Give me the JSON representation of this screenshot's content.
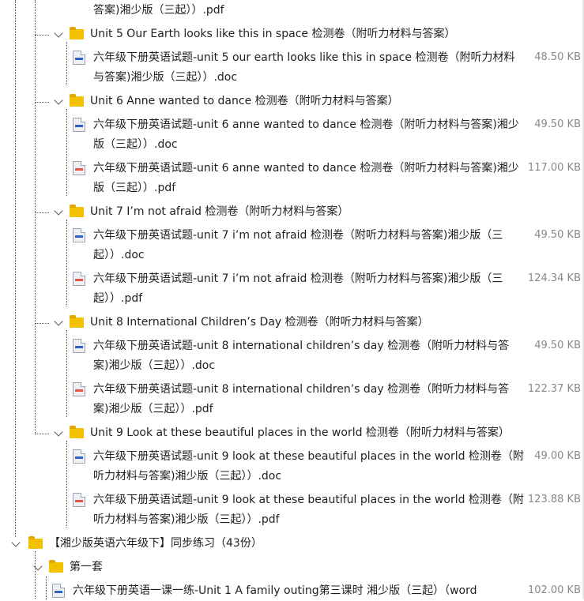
{
  "top_fragment": {
    "text": "答案)湘少版（三起））.pdf"
  },
  "folders": [
    {
      "label": "Unit 5 Our Earth looks like this in space 检测卷（附听力材料与答案）",
      "files": [
        {
          "type": "doc",
          "name": "六年级下册英语试题-unit 5 our earth looks like this in space 检测卷（附听力材料与答案)湘少版（三起））.doc",
          "size": "48.50 KB"
        }
      ]
    },
    {
      "label": "Unit 6 Anne wanted to dance 检测卷（附听力材料与答案）",
      "files": [
        {
          "type": "doc",
          "name": "六年级下册英语试题-unit 6 anne wanted to dance 检测卷（附听力材料与答案)湘少版（三起））.doc",
          "size": "49.50 KB"
        },
        {
          "type": "pdf",
          "name": "六年级下册英语试题-unit 6 anne wanted to dance 检测卷（附听力材料与答案)湘少版（三起））.pdf",
          "size": "117.00 KB"
        }
      ]
    },
    {
      "label": "Unit 7 I’m not afraid 检测卷（附听力材料与答案）",
      "files": [
        {
          "type": "doc",
          "name": "六年级下册英语试题-unit 7 i’m not afraid 检测卷（附听力材料与答案)湘少版（三起））.doc",
          "size": "49.50 KB"
        },
        {
          "type": "pdf",
          "name": "六年级下册英语试题-unit 7 i’m not afraid 检测卷（附听力材料与答案)湘少版（三起））.pdf",
          "size": "124.34 KB"
        }
      ]
    },
    {
      "label": "Unit 8 International Children’s Day 检测卷（附听力材料与答案）",
      "files": [
        {
          "type": "doc",
          "name": "六年级下册英语试题-unit 8 international children’s day 检测卷（附听力材料与答案)湘少版（三起））.doc",
          "size": "49.50 KB"
        },
        {
          "type": "pdf",
          "name": "六年级下册英语试题-unit 8 international children’s day 检测卷（附听力材料与答案)湘少版（三起））.pdf",
          "size": "122.37 KB"
        }
      ]
    },
    {
      "label": "Unit 9 Look at these beautiful places in the world 检测卷（附听力材料与答案）",
      "files": [
        {
          "type": "doc",
          "name": "六年级下册英语试题-unit 9 look at these beautiful places in the world 检测卷（附听力材料与答案)湘少版（三起））.doc",
          "size": "49.00 KB"
        },
        {
          "type": "pdf",
          "name": "六年级下册英语试题-unit 9 look at these beautiful places in the world 检测卷（附听力材料与答案)湘少版（三起））.pdf",
          "size": "123.88 KB"
        }
      ]
    }
  ],
  "section": {
    "label": "【湘少版英语六年级下】同步练习（43份）",
    "subfolder": {
      "label": "第一套",
      "first_file": {
        "type": "doc",
        "name": "六年级下册英语一课一练-Unit 1 A family outing第三课时 湘少版（三起）（word",
        "size": "102.00 KB"
      }
    }
  }
}
